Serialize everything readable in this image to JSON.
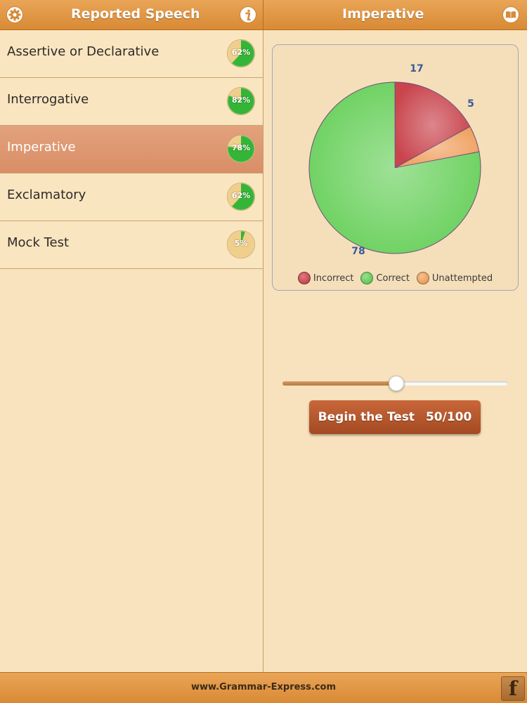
{
  "header": {
    "left_title": "Reported Speech",
    "right_title": "Imperative",
    "settings_icon": "gear-icon",
    "info_icon": "info-icon",
    "book_icon": "book-icon"
  },
  "topics": [
    {
      "label": "Assertive or Declarative",
      "progress_text": "62%",
      "progress": 62,
      "selected": false
    },
    {
      "label": "Interrogative",
      "progress_text": "82%",
      "progress": 82,
      "selected": false
    },
    {
      "label": "Imperative",
      "progress_text": "78%",
      "progress": 78,
      "selected": true
    },
    {
      "label": "Exclamatory",
      "progress_text": "62%",
      "progress": 62,
      "selected": false
    },
    {
      "label": "Mock Test",
      "progress_text": "5%",
      "progress": 5,
      "selected": false
    }
  ],
  "chart_data": {
    "type": "pie",
    "slices": [
      {
        "name": "Incorrect",
        "value": 17,
        "color": "#c9454e"
      },
      {
        "name": "Unattempted",
        "value": 5,
        "color": "#f0a262"
      },
      {
        "name": "Correct",
        "value": 78,
        "color": "#6cd15f"
      }
    ],
    "data_labels": [
      "17",
      "5",
      "78"
    ],
    "legend": [
      "Incorrect",
      "Correct",
      "Unattempted"
    ],
    "legend_colors": [
      "#c9454e",
      "#6cd15f",
      "#f0a262"
    ],
    "legend_position": "bottom"
  },
  "test_control": {
    "slider_value": 50,
    "slider_max": 100,
    "button_label": "Begin the Test",
    "button_count": "50/100"
  },
  "footer": {
    "url": "www.Grammar-Express.com",
    "facebook_icon": "facebook-icon",
    "facebook_glyph": "f"
  },
  "colors": {
    "bar": "#df9743",
    "panel": "#f8e3be",
    "selected_row": "#dd9870",
    "button": "#b45a2d",
    "progress_green": "#35b537",
    "progress_remaining": "#efcf8a"
  }
}
